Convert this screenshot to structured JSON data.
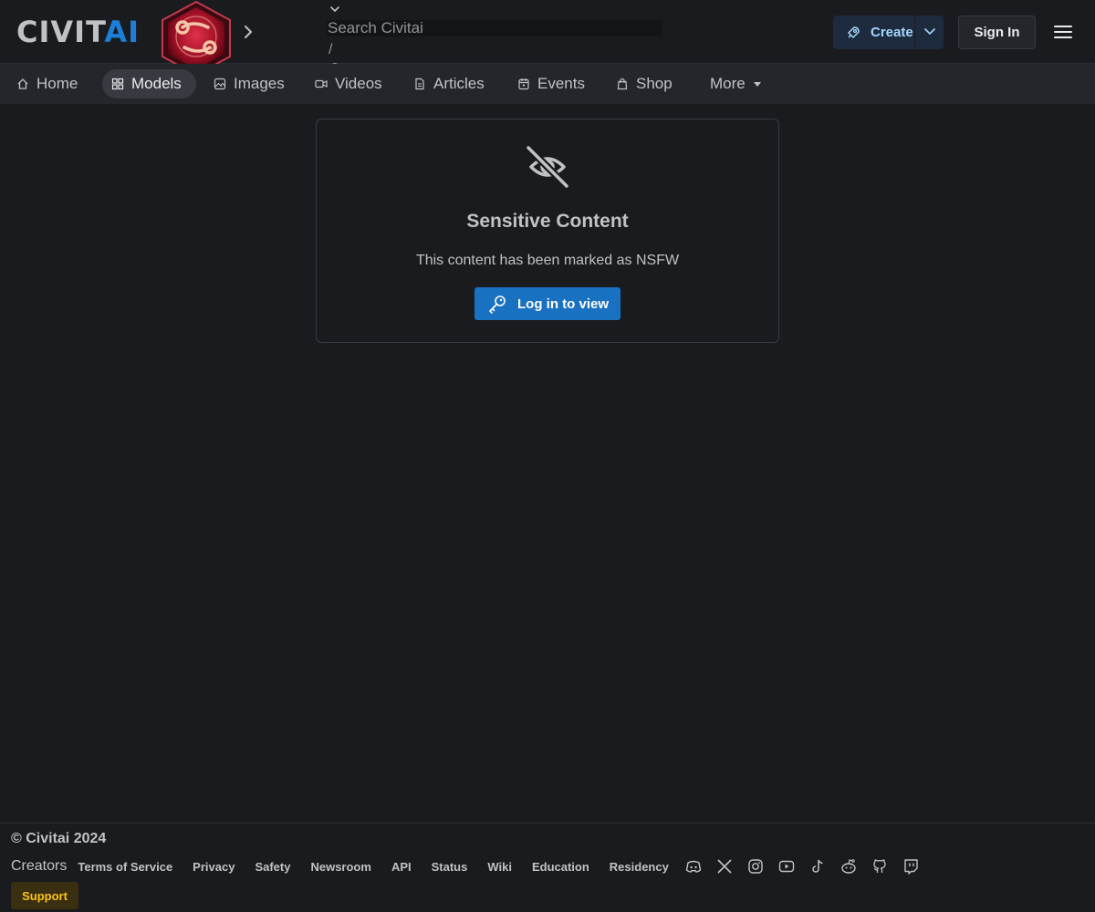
{
  "header": {
    "logo_civit": "CIVIT",
    "logo_ai": "AI",
    "search": {
      "placeholder": "Search Civitai",
      "shortcut": "/"
    },
    "create_label": "Create",
    "signin_label": "Sign In"
  },
  "nav": {
    "items": [
      {
        "label": "Home",
        "icon": "home-icon"
      },
      {
        "label": "Models",
        "icon": "grid-icon",
        "active": true
      },
      {
        "label": "Images",
        "icon": "photo-icon"
      },
      {
        "label": "Videos",
        "icon": "video-icon"
      },
      {
        "label": "Articles",
        "icon": "file-icon"
      },
      {
        "label": "Events",
        "icon": "calendar-icon"
      },
      {
        "label": "Shop",
        "icon": "shopping-bag-icon"
      },
      {
        "label": "More",
        "icon": "caret-down-icon"
      }
    ]
  },
  "card": {
    "title": "Sensitive Content",
    "message": "This content has been marked as NSFW",
    "button_label": "Log in to view"
  },
  "footer": {
    "copyright": "© Civitai 2024",
    "creators": "Creators",
    "links": [
      "Terms of Service",
      "Privacy",
      "Safety",
      "Newsroom",
      "API",
      "Status",
      "Wiki",
      "Education",
      "Residency"
    ],
    "social_icons": [
      "discord-icon",
      "x-icon",
      "instagram-icon",
      "youtube-icon",
      "tiktok-icon",
      "reddit-icon",
      "github-icon",
      "twitch-icon"
    ],
    "support_label": "Support"
  },
  "colors": {
    "background": "#1a1b1e",
    "nav_background": "#25262b",
    "accent_blue": "#1971c2",
    "logo_ai": "#1c7ed6",
    "support_yellow": "#fcc419"
  }
}
